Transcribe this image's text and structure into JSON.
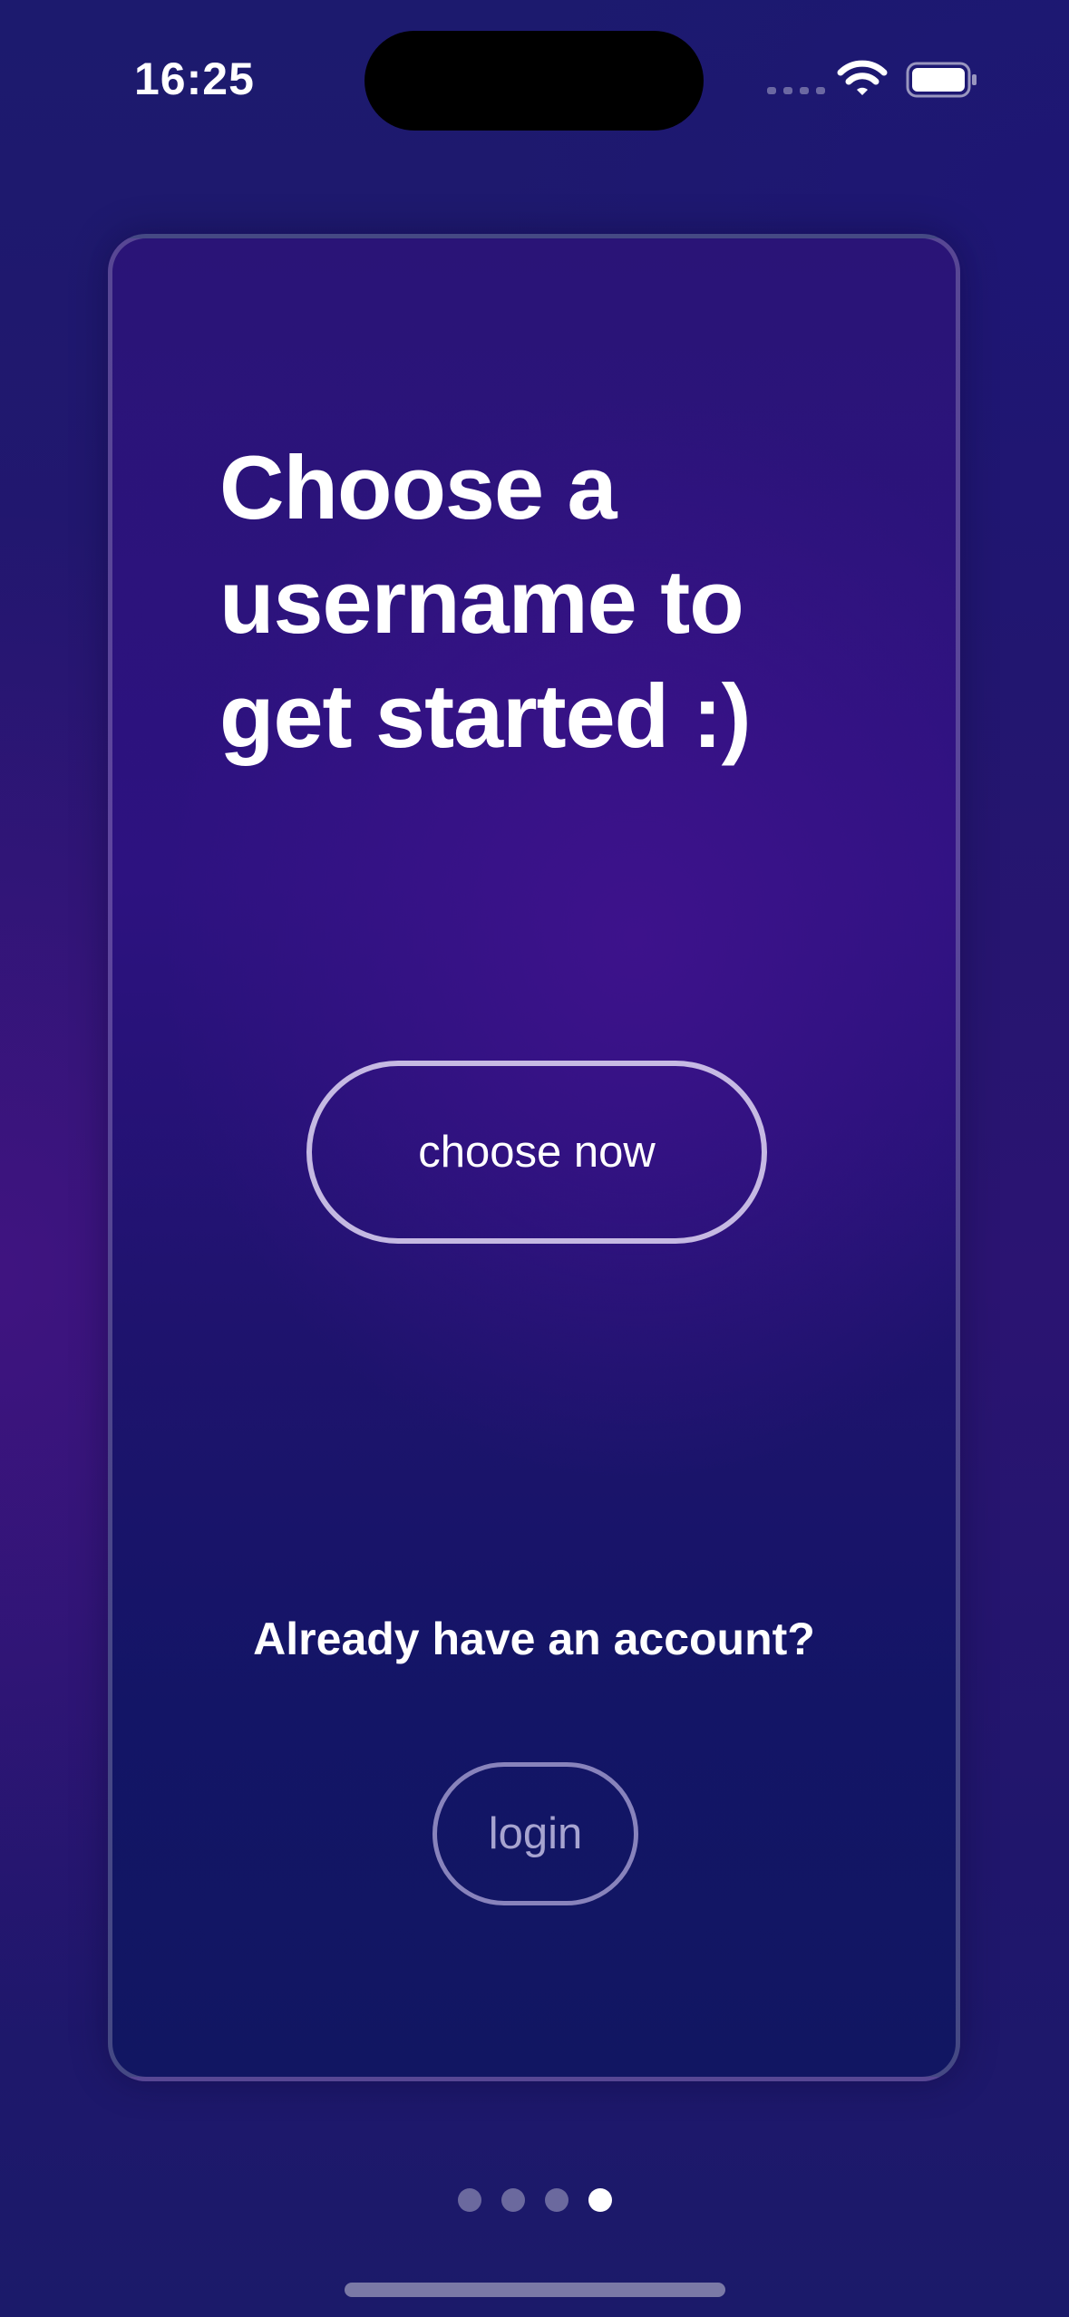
{
  "status_bar": {
    "time": "16:25",
    "icons": [
      "signal-icon",
      "wifi-icon",
      "battery-icon"
    ]
  },
  "onboarding": {
    "headline_lines": [
      "Choose a",
      "username to",
      "get started :)"
    ],
    "choose_button_label": "choose now",
    "already_account_text": "Already have an account?",
    "login_button_label": "login"
  },
  "pagination": {
    "total_pages": 4,
    "current_page": 4
  },
  "colors": {
    "background": "#221670",
    "card_top": "#2a1477",
    "card_bottom": "#111662",
    "text": "#ffffff"
  }
}
